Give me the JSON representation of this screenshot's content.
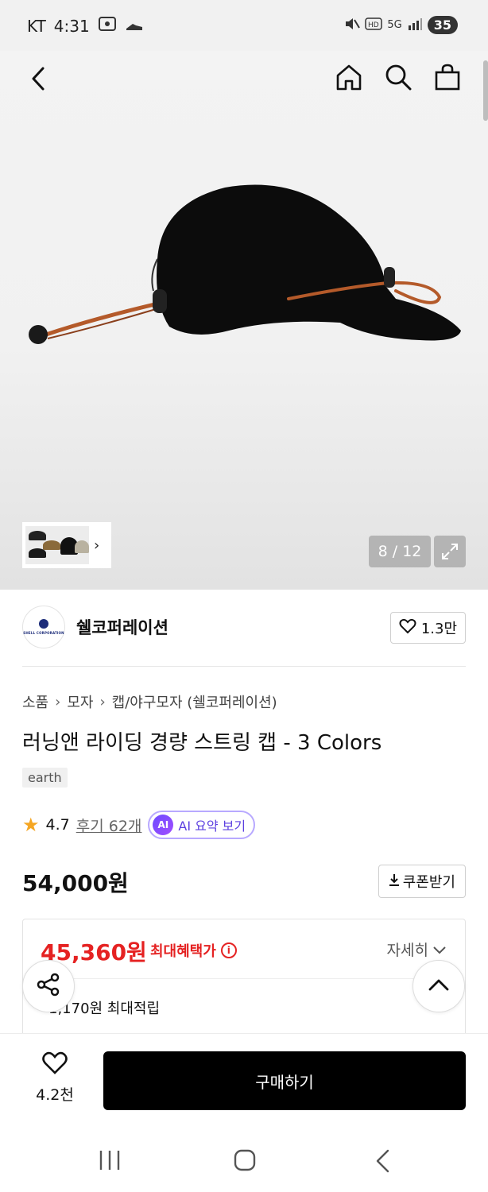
{
  "status_bar": {
    "carrier": "KT",
    "time": "4:31",
    "network": "5G",
    "battery": "35"
  },
  "nav": {
    "back_icon": "chevron-left-icon",
    "home_icon": "home-icon",
    "search_icon": "search-icon",
    "cart_icon": "shopping-bag-icon"
  },
  "gallery": {
    "counter": "8 / 12",
    "expand_icon": "expand-icon"
  },
  "brand": {
    "name": "쉘코퍼레이션",
    "logo_text": "SHELL CORPORATION",
    "like_count": "1.3만"
  },
  "breadcrumb": [
    "소품",
    "모자",
    "캡/야구모자 (쉘코퍼레이션)"
  ],
  "product": {
    "title": "러닝앤 라이딩 경량 스트링 캡 - 3 Colors",
    "tag": "earth",
    "rating": "4.7",
    "reviews": "후기 62개",
    "ai_badge": "AI",
    "ai_label": "AI 요약 보기",
    "price": "54,000원",
    "coupon_label": "쿠폰받기"
  },
  "benefit": {
    "max_price": "45,360원",
    "max_label": "최대혜택가",
    "detail_label": "자세히",
    "points": "1,170원 최대적립"
  },
  "bottom_bar": {
    "like_count": "4.2천",
    "buy_label": "구매하기"
  },
  "colors": {
    "accent_red": "#e52222",
    "ai_purple": "#5b3fe0",
    "buy_button": "#000000"
  }
}
